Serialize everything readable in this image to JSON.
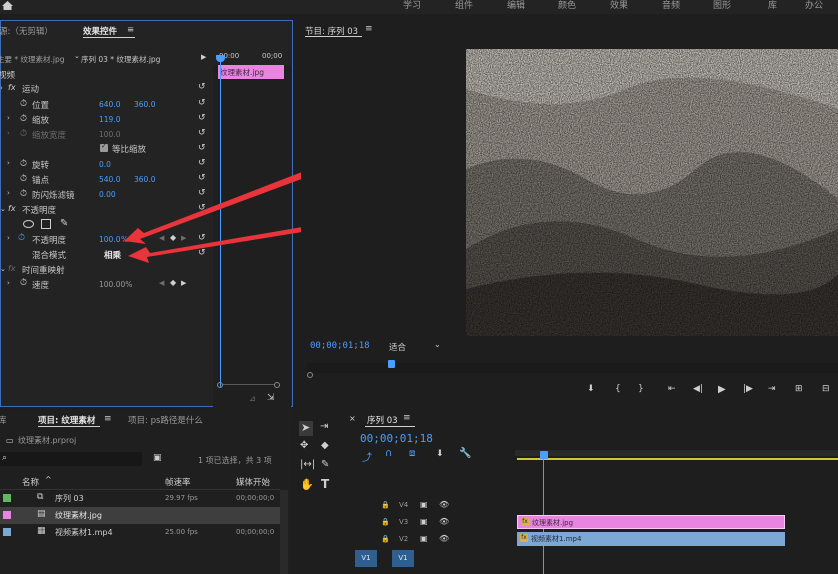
{
  "app": {
    "colors": {
      "accent": "#4a9eff",
      "panel_border": "#3c6fb8",
      "pink_clip": "#e985e0",
      "blue_clip": "#7ea8d4",
      "arrow": "#e8343a",
      "playhead": "#4a9eff",
      "work_area": "#c9c93a"
    }
  },
  "top_bar": {
    "home_icon": "home-icon",
    "workspaces": [
      "学习",
      "组件",
      "编辑",
      "颜色",
      "效果",
      "音频",
      "图形",
      "库",
      "办公"
    ]
  },
  "effect_controls": {
    "tabs": {
      "source": "源:（无剪辑）",
      "effect_controls": "效果控件",
      "menu_icon": "≡"
    },
    "master_clip": "主要 * 纹理素材.jpg",
    "sequence_clip": "序列 03 * 纹理素材.jpg",
    "timecodes": [
      "00:00",
      "00;00"
    ],
    "clip_label": "纹理素材.jpg",
    "section_video": "视频",
    "motion": {
      "label": "运动",
      "position": {
        "label": "位置",
        "x": "640.0",
        "y": "360.0"
      },
      "scale": {
        "label": "缩放",
        "value": "119.0"
      },
      "scale_width": {
        "label": "缩放宽度",
        "value": "100.0"
      },
      "uniform_scale": "等比缩放",
      "rotation": {
        "label": "旋转",
        "value": "0.0"
      },
      "anchor": {
        "label": "锚点",
        "x": "540.0",
        "y": "360.0"
      },
      "antiflicker": {
        "label": "防闪烁滤镜",
        "value": "0.00"
      }
    },
    "opacity": {
      "label": "不透明度",
      "opacity_row": {
        "label": "不透明度",
        "value": "100.0",
        "unit": "%"
      },
      "blend_mode": {
        "label": "混合模式",
        "value": "相乘"
      }
    },
    "time_remap": {
      "label": "时间重映射",
      "speed": {
        "label": "速度",
        "value": "100.00%"
      }
    }
  },
  "program_monitor": {
    "title": "节目: 序列 03",
    "menu_icon": "≡",
    "timecode": "00;00;01;18",
    "fit": "适合",
    "controls": [
      "marker",
      "in",
      "out",
      "go-to-in",
      "step-back",
      "play",
      "step-forward",
      "go-to-out",
      "insert",
      "overwrite"
    ]
  },
  "project_panel": {
    "tabs": [
      "库",
      "项目: 纹理素材",
      "项目: ps路径是什么"
    ],
    "menu_icon": "≡",
    "file_name": "纹理素材.prproj",
    "status": "1 项已选择，共 3 项",
    "columns": [
      "名称",
      "帧速率",
      "媒体开始"
    ],
    "items": [
      {
        "name": "序列 03",
        "fps": "29.97 fps",
        "start": "00;00;00;0",
        "swatch": "#5fba5f",
        "type": "sequence"
      },
      {
        "name": "纹理素材.jpg",
        "fps": "",
        "start": "",
        "swatch": "#e985e0",
        "type": "image"
      },
      {
        "name": "视频素材1.mp4",
        "fps": "25.00 fps",
        "start": "00;00;00;0",
        "swatch": "#7ea8d4",
        "type": "video"
      }
    ]
  },
  "timeline": {
    "title": "序列 03",
    "menu_icon": "≡",
    "timecode": "00;00;01;18",
    "tracks": [
      {
        "name": "V4"
      },
      {
        "name": "V3"
      },
      {
        "name": "V2"
      },
      {
        "name": "V1",
        "source_patch": "V1"
      }
    ],
    "clips": [
      {
        "name": "纹理素材.jpg",
        "track": "V3"
      },
      {
        "name": "视频素材1.mp4",
        "track": "V2"
      }
    ]
  },
  "tools": [
    "selection",
    "track-select",
    "ripple",
    "razor",
    "slip",
    "pen",
    "hand",
    "type"
  ]
}
